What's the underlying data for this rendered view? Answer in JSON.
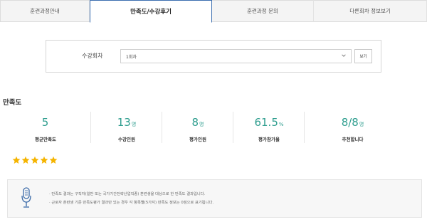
{
  "tabs": [
    {
      "label": "훈련과정안내",
      "active": false
    },
    {
      "label": "만족도/수강후기",
      "active": true
    },
    {
      "label": "훈련과정 문의",
      "active": false
    },
    {
      "label": "다른회차 정보보기",
      "active": false
    }
  ],
  "filter": {
    "label": "수강회차",
    "selected": "1회차",
    "button": "보기"
  },
  "section_title": "만족도",
  "stats": [
    {
      "value": "5",
      "unit": "",
      "label": "평균만족도"
    },
    {
      "value": "13",
      "unit": "명",
      "label": "수강인원"
    },
    {
      "value": "8",
      "unit": "명",
      "label": "평가인원"
    },
    {
      "value": "61.5",
      "unit": "%",
      "label": "평가참가율"
    },
    {
      "value": "8/8",
      "unit": "명",
      "label": "추천합니다"
    }
  ],
  "rating": {
    "stars": 5,
    "max": 5
  },
  "colors": {
    "accent": "#2f9e8f",
    "star": "#f5b400",
    "tab_border": "#3d6fb0"
  },
  "note": {
    "icon": "microphone-icon",
    "lines": [
      "· 만족도 결과는 구직자(일반 또는 국가기간전략산업직종) 훈련생을 대상으로 한 만족도 결과입니다.",
      "· 근로자 훈련생 기준 만족도평가 결과만 있는 경우 각 항목별(5가지) 만족도 정보는 0점으로 표기됩니다."
    ]
  }
}
